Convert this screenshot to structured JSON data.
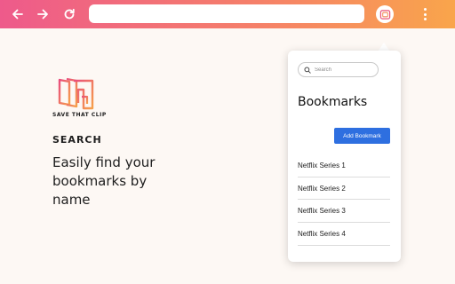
{
  "browser": {
    "back_icon": "arrow-left-icon",
    "forward_icon": "arrow-right-icon",
    "reload_icon": "reload-icon",
    "address_value": "",
    "extension_icon": "save-that-clip-logo-icon",
    "menu_icon": "kebab-menu-icon",
    "bar_colors": [
      "#ee5a8b",
      "#f57f6a",
      "#f9a54b"
    ]
  },
  "landing": {
    "brand": "SAVE THAT CLIP",
    "section_title": "SEARCH",
    "tagline": "Easily find your bookmarks by name"
  },
  "popup": {
    "search_placeholder": "Search",
    "title": "Bookmarks",
    "add_button": "Add Bookmark",
    "bookmarks": [
      {
        "label": "Netflix Series 1"
      },
      {
        "label": "Netflix Series 2"
      },
      {
        "label": "Netflix Series 3"
      },
      {
        "label": "Netflix Series 4"
      }
    ],
    "accent": "#2e6fe0"
  }
}
